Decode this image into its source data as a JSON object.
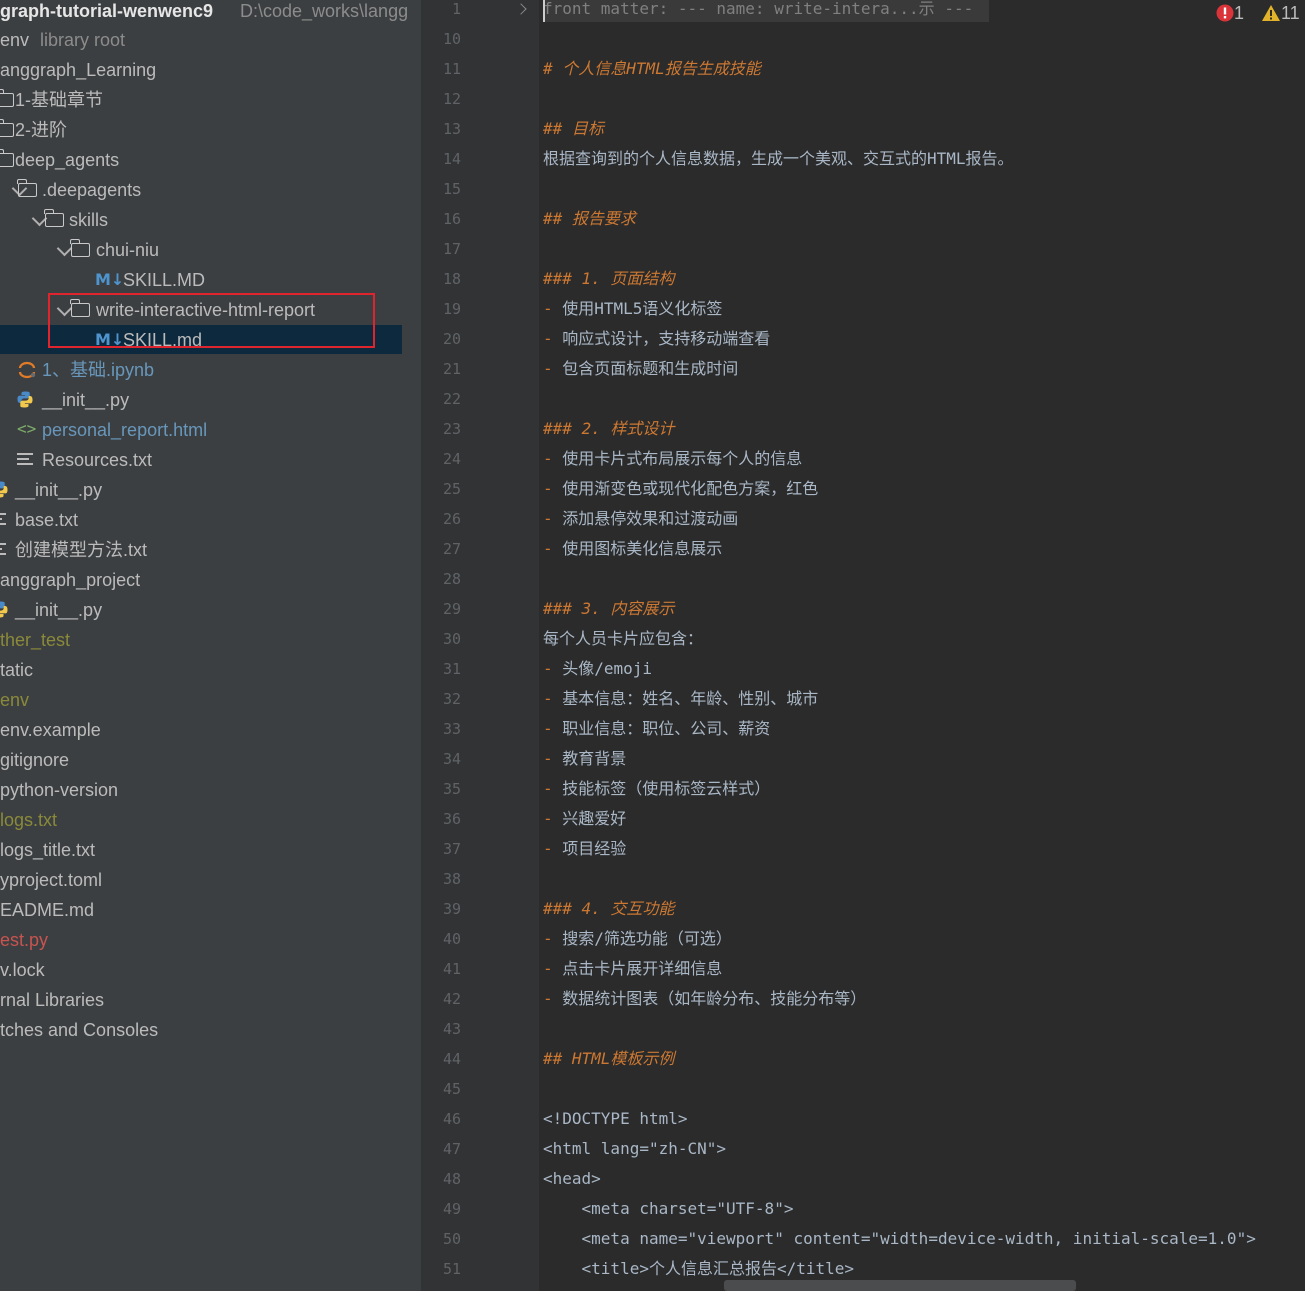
{
  "project": {
    "root_name": "graph-tutorial-wenwenc9",
    "root_path": "D:\\code_works\\langg"
  },
  "tree": [
    {
      "label": "env",
      "suffix": "library root",
      "color": "#bbbbbb",
      "icon": "none"
    },
    {
      "label": "anggraph_Learning",
      "color": "#bbbbbb",
      "icon": "none"
    },
    {
      "label": "1-基础章节",
      "color": "#bbbbbb",
      "icon": "folder-icon"
    },
    {
      "label": "2-进阶",
      "color": "#bbbbbb",
      "icon": "folder-icon"
    },
    {
      "label": "deep_agents",
      "color": "#bbbbbb",
      "icon": "folder-icon"
    },
    {
      "label": ".deepagents",
      "color": "#bbbbbb",
      "icon": "folder-icon"
    },
    {
      "label": "skills",
      "color": "#bbbbbb",
      "icon": "folder-icon"
    },
    {
      "label": "chui-niu",
      "color": "#bbbbbb",
      "icon": "folder-icon"
    },
    {
      "label": "SKILL.MD",
      "color": "#bbbbbb",
      "icon": "markdown-icon"
    },
    {
      "label": "write-interactive-html-report",
      "color": "#bbbbbb",
      "icon": "folder-icon"
    },
    {
      "label": "SKILL.md",
      "color": "#bbbbbb",
      "icon": "markdown-icon"
    },
    {
      "label": "1、基础.ipynb",
      "color": "#6897bb",
      "icon": "notebook-icon"
    },
    {
      "label": "__init__.py",
      "color": "#bbbbbb",
      "icon": "python-icon"
    },
    {
      "label": "personal_report.html",
      "color": "#6897bb",
      "icon": "html-icon"
    },
    {
      "label": "Resources.txt",
      "color": "#bbbbbb",
      "icon": "text-file-icon"
    },
    {
      "label": "__init__.py",
      "color": "#bbbbbb",
      "icon": "python-icon"
    },
    {
      "label": "base.txt",
      "color": "#bbbbbb",
      "icon": "text-file-icon"
    },
    {
      "label": "创建模型方法.txt",
      "color": "#bbbbbb",
      "icon": "text-file-icon"
    },
    {
      "label": "anggraph_project",
      "color": "#bbbbbb",
      "icon": "none"
    },
    {
      "label": "__init__.py",
      "color": "#bbbbbb",
      "icon": "python-icon"
    },
    {
      "label": "ther_test",
      "color": "#8a8a3a",
      "icon": "none"
    },
    {
      "label": "tatic",
      "color": "#bbbbbb",
      "icon": "none"
    },
    {
      "label": "env",
      "color": "#8a8a3a",
      "icon": "none"
    },
    {
      "label": "env.example",
      "color": "#bbbbbb",
      "icon": "none"
    },
    {
      "label": "gitignore",
      "color": "#bbbbbb",
      "icon": "none"
    },
    {
      "label": "python-version",
      "color": "#bbbbbb",
      "icon": "none"
    },
    {
      "label": "logs.txt",
      "color": "#8a8a3a",
      "icon": "none"
    },
    {
      "label": "logs_title.txt",
      "color": "#bbbbbb",
      "icon": "none"
    },
    {
      "label": "yproject.toml",
      "color": "#bbbbbb",
      "icon": "none"
    },
    {
      "label": "EADME.md",
      "color": "#bbbbbb",
      "icon": "none"
    },
    {
      "label": "est.py",
      "color": "#c75450",
      "icon": "none"
    },
    {
      "label": "v.lock",
      "color": "#bbbbbb",
      "icon": "none"
    },
    {
      "label": "rnal Libraries",
      "color": "#bbbbbb",
      "icon": "none"
    },
    {
      "label": "tches and Consoles",
      "color": "#bbbbbb",
      "icon": "none"
    }
  ],
  "status": {
    "errors": "1",
    "warnings": "11"
  },
  "editor": {
    "lines": [
      {
        "n": "1",
        "parts": [
          {
            "t": "front matter: --- name: write-intera...示 ---",
            "c": "fm"
          }
        ]
      },
      {
        "n": "10",
        "parts": []
      },
      {
        "n": "11",
        "parts": [
          {
            "t": "# 个人信息HTML报告生成技能",
            "c": "h"
          }
        ]
      },
      {
        "n": "12",
        "parts": []
      },
      {
        "n": "13",
        "parts": [
          {
            "t": "## 目标",
            "c": "h"
          }
        ]
      },
      {
        "n": "14",
        "parts": [
          {
            "t": "根据查询到的个人信息数据，生成一个美观、交互式的HTML报告。",
            "c": ""
          }
        ]
      },
      {
        "n": "15",
        "parts": []
      },
      {
        "n": "16",
        "parts": [
          {
            "t": "## 报告要求",
            "c": "h"
          }
        ]
      },
      {
        "n": "17",
        "parts": []
      },
      {
        "n": "18",
        "parts": [
          {
            "t": "### 1. 页面结构",
            "c": "h"
          }
        ]
      },
      {
        "n": "19",
        "parts": [
          {
            "t": "- ",
            "c": "dash"
          },
          {
            "t": "使用HTML5语义化标签",
            "c": ""
          }
        ]
      },
      {
        "n": "20",
        "parts": [
          {
            "t": "- ",
            "c": "dash"
          },
          {
            "t": "响应式设计，支持移动端查看",
            "c": ""
          }
        ]
      },
      {
        "n": "21",
        "parts": [
          {
            "t": "- ",
            "c": "dash"
          },
          {
            "t": "包含页面标题和生成时间",
            "c": ""
          }
        ]
      },
      {
        "n": "22",
        "parts": []
      },
      {
        "n": "23",
        "parts": [
          {
            "t": "### 2. 样式设计",
            "c": "h"
          }
        ]
      },
      {
        "n": "24",
        "parts": [
          {
            "t": "- ",
            "c": "dash"
          },
          {
            "t": "使用卡片式布局展示每个人的信息",
            "c": ""
          }
        ]
      },
      {
        "n": "25",
        "parts": [
          {
            "t": "- ",
            "c": "dash"
          },
          {
            "t": "使用渐变色或现代化配色方案，红色",
            "c": ""
          }
        ]
      },
      {
        "n": "26",
        "parts": [
          {
            "t": "- ",
            "c": "dash"
          },
          {
            "t": "添加悬停效果和过渡动画",
            "c": ""
          }
        ]
      },
      {
        "n": "27",
        "parts": [
          {
            "t": "- ",
            "c": "dash"
          },
          {
            "t": "使用图标美化信息展示",
            "c": ""
          }
        ]
      },
      {
        "n": "28",
        "parts": []
      },
      {
        "n": "29",
        "parts": [
          {
            "t": "### 3. 内容展示",
            "c": "h"
          }
        ]
      },
      {
        "n": "30",
        "parts": [
          {
            "t": "每个人员卡片应包含：",
            "c": ""
          }
        ]
      },
      {
        "n": "31",
        "parts": [
          {
            "t": "- ",
            "c": "dash"
          },
          {
            "t": "头像/emoji",
            "c": ""
          }
        ]
      },
      {
        "n": "32",
        "parts": [
          {
            "t": "- ",
            "c": "dash"
          },
          {
            "t": "基本信息：姓名、年龄、性别、城市",
            "c": ""
          }
        ]
      },
      {
        "n": "33",
        "parts": [
          {
            "t": "- ",
            "c": "dash"
          },
          {
            "t": "职业信息：职位、公司、薪资",
            "c": ""
          }
        ]
      },
      {
        "n": "34",
        "parts": [
          {
            "t": "- ",
            "c": "dash"
          },
          {
            "t": "教育背景",
            "c": ""
          }
        ]
      },
      {
        "n": "35",
        "parts": [
          {
            "t": "- ",
            "c": "dash"
          },
          {
            "t": "技能标签（使用标签云样式）",
            "c": ""
          }
        ]
      },
      {
        "n": "36",
        "parts": [
          {
            "t": "- ",
            "c": "dash"
          },
          {
            "t": "兴趣爱好",
            "c": ""
          }
        ]
      },
      {
        "n": "37",
        "parts": [
          {
            "t": "- ",
            "c": "dash"
          },
          {
            "t": "项目经验",
            "c": ""
          }
        ]
      },
      {
        "n": "38",
        "parts": []
      },
      {
        "n": "39",
        "parts": [
          {
            "t": "### 4. 交互功能",
            "c": "h"
          }
        ]
      },
      {
        "n": "40",
        "parts": [
          {
            "t": "- ",
            "c": "dash"
          },
          {
            "t": "搜索/筛选功能（可选）",
            "c": ""
          }
        ]
      },
      {
        "n": "41",
        "parts": [
          {
            "t": "- ",
            "c": "dash"
          },
          {
            "t": "点击卡片展开详细信息",
            "c": ""
          }
        ]
      },
      {
        "n": "42",
        "parts": [
          {
            "t": "- ",
            "c": "dash"
          },
          {
            "t": "数据统计图表（如年龄分布、技能分布等）",
            "c": ""
          }
        ]
      },
      {
        "n": "43",
        "parts": []
      },
      {
        "n": "44",
        "parts": [
          {
            "t": "## HTML模板示例",
            "c": "h"
          }
        ]
      },
      {
        "n": "45",
        "parts": []
      },
      {
        "n": "46",
        "parts": [
          {
            "t": "<!DOCTYPE html>",
            "c": ""
          }
        ]
      },
      {
        "n": "47",
        "parts": [
          {
            "t": "<html lang=\"zh-CN\">",
            "c": ""
          }
        ]
      },
      {
        "n": "48",
        "parts": [
          {
            "t": "<head>",
            "c": ""
          }
        ]
      },
      {
        "n": "49",
        "parts": [
          {
            "t": "    <meta charset=\"UTF-8\">",
            "c": ""
          }
        ]
      },
      {
        "n": "50",
        "parts": [
          {
            "t": "    <meta name=\"viewport\" content=\"width=device-width, initial-scale=1.0\">",
            "c": ""
          }
        ]
      },
      {
        "n": "51",
        "parts": [
          {
            "t": "    <title>个人信息汇总报告</title>",
            "c": ""
          }
        ]
      }
    ]
  },
  "colors": {
    "tree_bg": "#3c3f41",
    "editor_bg": "#2b2b2b",
    "heading": "#cc7832",
    "selection": "#0d293e",
    "highlight_box": "#e0242e"
  }
}
